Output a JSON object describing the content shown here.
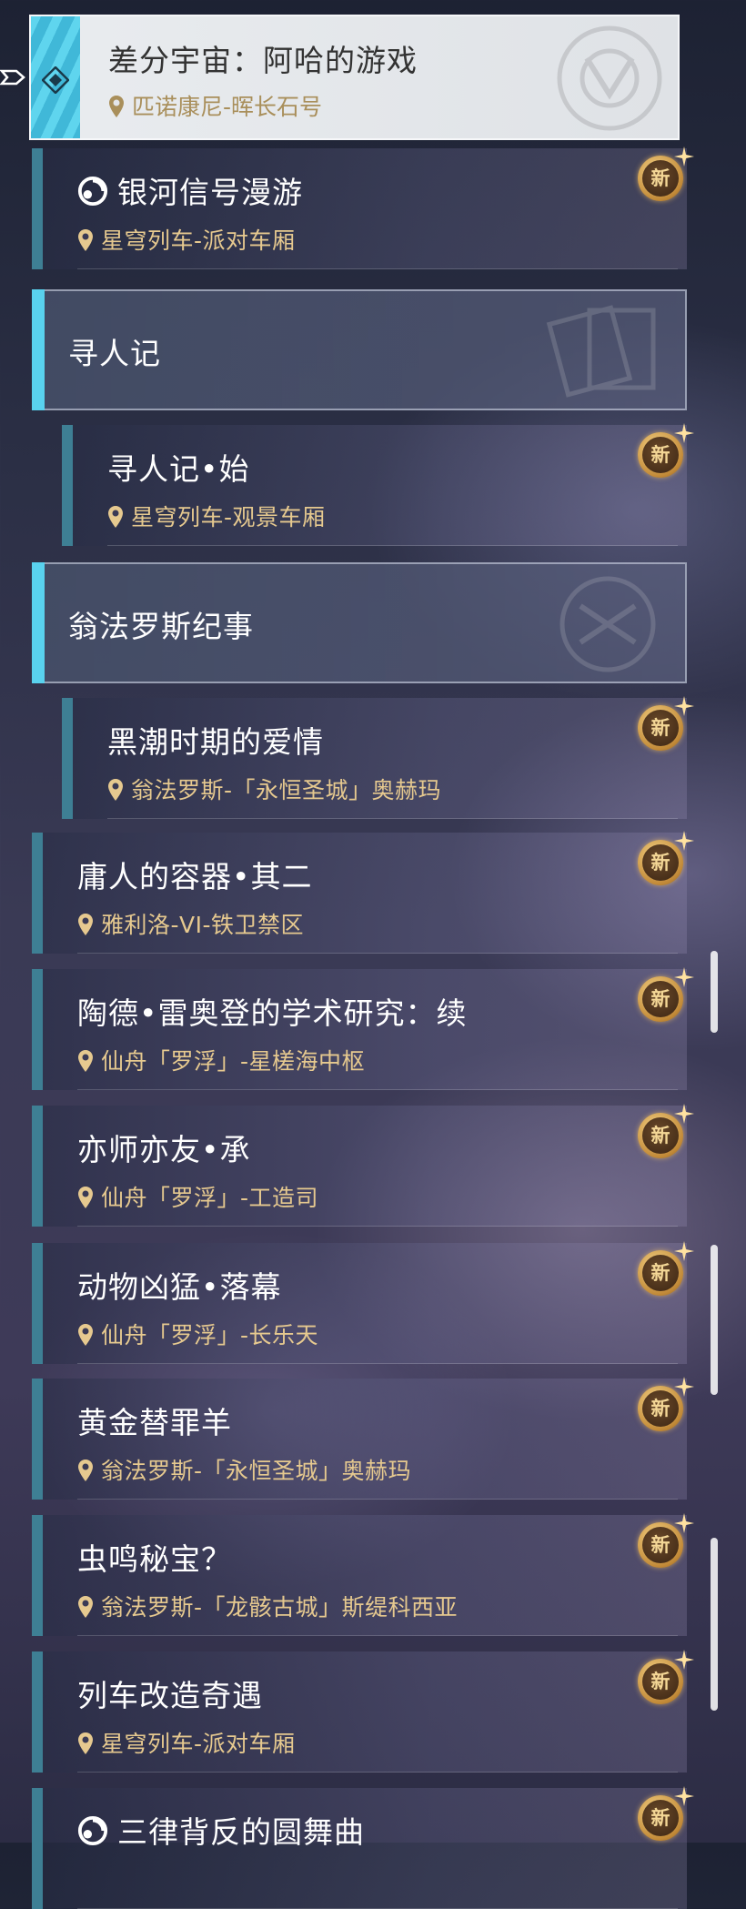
{
  "selected": {
    "title": "差分宇宙：阿哈的游戏",
    "location": "匹诺康尼-晖长石号"
  },
  "badge_label": "新",
  "colors": {
    "accent_cyan": "#59d2ee",
    "row_bar": "#3e7f94",
    "location_gold": "#e6c98f"
  },
  "items": [
    {
      "title": "银河信号漫游",
      "location": "星穹列车-派对车厢",
      "new": true,
      "icon": "signal-icon"
    },
    {
      "group": "寻人记"
    },
    {
      "title": "寻人记•始",
      "location": "星穹列车-观景车厢",
      "new": true,
      "sub": true
    },
    {
      "group": "翁法罗斯纪事"
    },
    {
      "title": "黑潮时期的爱情",
      "location": "翁法罗斯-「永恒圣城」奥赫玛",
      "new": true,
      "sub": true
    },
    {
      "title": "庸人的容器•其二",
      "location": "雅利洛-VI-铁卫禁区",
      "new": true
    },
    {
      "title": "陶德•雷奥登的学术研究：续",
      "location": "仙舟「罗浮」-星槎海中枢",
      "new": true
    },
    {
      "title": "亦师亦友•承",
      "location": "仙舟「罗浮」-工造司",
      "new": true
    },
    {
      "title": "动物凶猛•落幕",
      "location": "仙舟「罗浮」-长乐天",
      "new": true
    },
    {
      "title": "黄金替罪羊",
      "location": "翁法罗斯-「永恒圣城」奥赫玛",
      "new": true
    },
    {
      "title": "虫鸣秘宝？",
      "location": "翁法罗斯-「龙骸古城」斯缇科西亚",
      "new": true
    },
    {
      "title": "列车改造奇遇",
      "location": "星穹列车-派对车厢",
      "new": true
    },
    {
      "title": "三律背反的圆舞曲",
      "location": "",
      "new": true,
      "icon": "signal-icon"
    }
  ]
}
